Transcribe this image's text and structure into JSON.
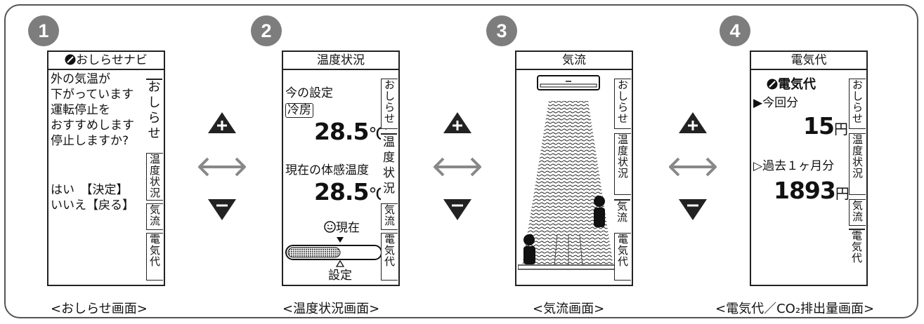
{
  "steps": [
    "1",
    "2",
    "3",
    "4"
  ],
  "panel1": {
    "title": "おしらせナビ",
    "lines": [
      "外の気温が",
      "下がっています",
      "運転停止を",
      "おすすめします",
      "停止しますか?"
    ],
    "options": [
      "はい　【決定】",
      "いいえ【戻る】"
    ],
    "tabs": [
      "おしらせ",
      "温度状況",
      "気流",
      "電気代"
    ],
    "caption": "<おしらせ画面>"
  },
  "panel2": {
    "title": "温度状況",
    "setting_label": "今の設定",
    "mode": "冷房",
    "set_temp": "28.5",
    "unit": "℃",
    "feel_label": "現在の体感温度",
    "feel_temp": "28.5",
    "now_label": "現在",
    "set_label": "設定",
    "tabs": [
      "おしらせ",
      "温度状況",
      "気流",
      "電気代"
    ],
    "caption": "<温度状況画面>"
  },
  "panel3": {
    "title": "気流",
    "tabs": [
      "おしらせ",
      "温度状況",
      "気流",
      "電気代"
    ],
    "caption": "<気流画面>"
  },
  "panel4": {
    "title": "電気代",
    "heading": "電気代",
    "current_label": "▶今回分",
    "current_value": "15",
    "yen": "円",
    "past_label": "▷過去１ヶ月分",
    "past_value": "1893",
    "tabs": [
      "おしらせ",
      "温度状況",
      "気流",
      "電気代"
    ],
    "caption": "<電気代／CO₂排出量画面>"
  },
  "nav_icons": [
    "up-triangle-plus-icon",
    "double-arrow-icon",
    "down-triangle-minus-icon"
  ]
}
